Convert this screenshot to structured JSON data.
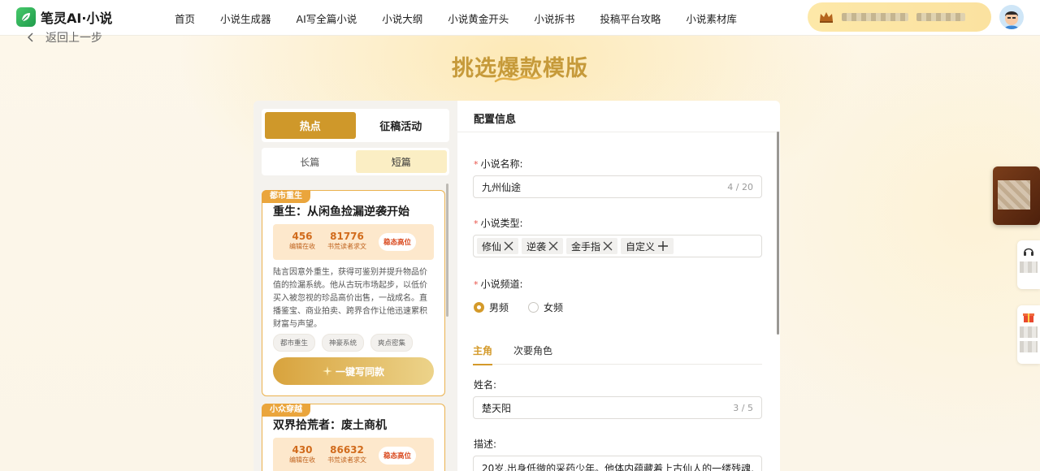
{
  "header": {
    "logo_text": "笔灵AI·小说",
    "nav": [
      "首页",
      "小说生成器",
      "AI写全篇小说",
      "小说大纲",
      "小说黄金开头",
      "小说拆书",
      "投稿平台攻略",
      "小说素材库"
    ]
  },
  "back_label": "返回上一步",
  "page_title": "挑选爆款模版",
  "left": {
    "tabs": [
      "热点",
      "征稿活动"
    ],
    "subtabs": [
      "长篇",
      "短篇"
    ],
    "cards": [
      {
        "tag": "都市重生",
        "title": "重生：从闲鱼捡漏逆袭开始",
        "stat1_value": "456",
        "stat1_label": "编辑在收",
        "stat2_value": "81776",
        "stat2_label": "书荒读者求文",
        "badge": "稳态高位",
        "desc": "陆言因意外重生，获得可鉴别并提升物品价值的捡漏系统。他从古玩市场起步，以低价买入被忽视的珍品高价出售，一战成名。直播鉴宝、商业拍卖、跨界合作让他迅速累积财富与声望。",
        "chips": [
          "都市重生",
          "神豪系统",
          "爽点密集"
        ],
        "button": "一键写同款"
      },
      {
        "tag": "小众穿越",
        "title": "双界拾荒者：废土商机",
        "stat1_value": "430",
        "stat1_label": "编辑在收",
        "stat2_value": "86632",
        "stat2_label": "书荒读者求文",
        "badge": "稳态高位"
      }
    ]
  },
  "right": {
    "header": "配置信息",
    "name_label": "小说名称:",
    "name_value": "九州仙途",
    "name_counter": "4 / 20",
    "type_label": "小说类型:",
    "type_tags": [
      "修仙",
      "逆袭",
      "金手指"
    ],
    "custom_tag": "自定义",
    "channel_label": "小说频道:",
    "channel_options": [
      "男频",
      "女频"
    ],
    "channel_selected": "男频",
    "role_tabs": [
      "主角",
      "次要角色"
    ],
    "role_name_label": "姓名:",
    "role_name_value": "楚天阳",
    "role_name_counter": "3 / 5",
    "desc_label": "描述:",
    "desc_value": "20岁,出身低微的采药少年。他体内蕴藏着上古仙人的一缕残魂,"
  },
  "colors": {
    "accent": "#cf982a",
    "tag_orange": "#eaa53c",
    "stat_bg": "#fde8cc"
  }
}
